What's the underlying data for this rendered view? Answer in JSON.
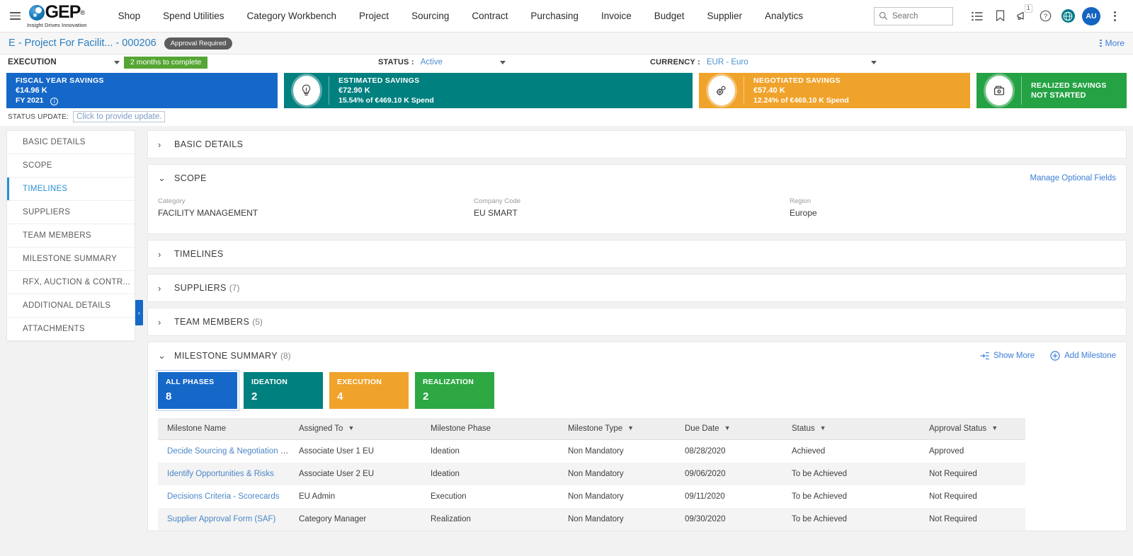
{
  "topnav": {
    "logo_text": "GEP",
    "logo_reg": "®",
    "logo_tagline": "Insight Drives Innovation",
    "links": [
      {
        "label": "Shop"
      },
      {
        "label": "Spend Utilities"
      },
      {
        "label": "Category Workbench"
      },
      {
        "label": "Project"
      },
      {
        "label": "Sourcing"
      },
      {
        "label": "Contract"
      },
      {
        "label": "Purchasing"
      },
      {
        "label": "Invoice"
      },
      {
        "label": "Budget"
      },
      {
        "label": "Supplier"
      },
      {
        "label": "Analytics"
      }
    ],
    "search_placeholder": "Search",
    "search_value": "",
    "notification_badge": "1",
    "avatar_initials": "AU"
  },
  "titlebar": {
    "project_name": "E - Project For Facilit...",
    "project_number": "- 000206",
    "approval_badge": "Approval Required",
    "more_label": "More"
  },
  "phasebar": {
    "phase": "EXECUTION",
    "months_chip": "2 months to complete",
    "status_label": "STATUS :",
    "status_value": "Active",
    "currency_label": "CURRENCY :",
    "currency_value": "EUR - Euro"
  },
  "kpis": [
    {
      "title": "FISCAL YEAR SAVINGS",
      "value": "€14.96 K",
      "sub": "FY 2021",
      "color": "#1668c8",
      "icon": "none",
      "has_info": true
    },
    {
      "title": "ESTIMATED SAVINGS",
      "value": "€72.90 K",
      "sub": "15.54% of €469.10 K Spend",
      "color": "#00807f",
      "icon": "lightbulb-icon"
    },
    {
      "title": "NEGOTIATED SAVINGS",
      "value": "€57.40 K",
      "sub": "12.24% of €469.10 K Spend",
      "color": "#f0a32b",
      "icon": "gears-icon"
    },
    {
      "title": "REALIZED SAVINGS",
      "value": "NOT STARTED",
      "sub": "",
      "color": "#25a244",
      "icon": "wallet-icon"
    }
  ],
  "status_update": {
    "label": "STATUS UPDATE:",
    "placeholder": "Click to provide update."
  },
  "sidebar": {
    "items": [
      {
        "label": "BASIC DETAILS",
        "active": false
      },
      {
        "label": "SCOPE",
        "active": false
      },
      {
        "label": "TIMELINES",
        "active": true
      },
      {
        "label": "SUPPLIERS",
        "active": false
      },
      {
        "label": "TEAM MEMBERS",
        "active": false
      },
      {
        "label": "MILESTONE SUMMARY",
        "active": false
      },
      {
        "label": "RFX, AUCTION & CONTR...",
        "active": false
      },
      {
        "label": "ADDITIONAL DETAILS",
        "active": false
      },
      {
        "label": "ATTACHMENTS",
        "active": false
      }
    ]
  },
  "sections": {
    "basic_details": {
      "title": "BASIC DETAILS",
      "chevron": "›"
    },
    "scope": {
      "title": "SCOPE",
      "chevron": "⌄",
      "manage_link": "Manage Optional Fields",
      "fields": [
        {
          "label": "Category",
          "value": "FACILITY MANAGEMENT"
        },
        {
          "label": "Company Code",
          "value": "EU SMART"
        },
        {
          "label": "Region",
          "value": "Europe"
        }
      ]
    },
    "timelines": {
      "title": "TIMELINES",
      "chevron": "›"
    },
    "suppliers": {
      "title": "SUPPLIERS",
      "count": "(7)",
      "chevron": "›"
    },
    "team_members": {
      "title": "TEAM MEMBERS",
      "count": "(5)",
      "chevron": "›"
    },
    "milestone_summary": {
      "title": "MILESTONE SUMMARY",
      "count": "(8)",
      "chevron": "⌄",
      "show_more": "Show More",
      "add_milestone": "Add Milestone",
      "phase_cards": [
        {
          "label": "ALL PHASES",
          "count": "8",
          "color": "#1668c8",
          "selected": true
        },
        {
          "label": "IDEATION",
          "count": "2",
          "color": "#00807f",
          "selected": false
        },
        {
          "label": "EXECUTION",
          "count": "4",
          "color": "#f0a32b",
          "selected": false
        },
        {
          "label": "REALIZATION",
          "count": "2",
          "color": "#2da843",
          "selected": false
        }
      ],
      "table": {
        "columns": [
          {
            "label": "Milestone Name",
            "filter": false
          },
          {
            "label": "Assigned To",
            "filter": true
          },
          {
            "label": "Milestone Phase",
            "filter": false
          },
          {
            "label": "Milestone Type",
            "filter": true
          },
          {
            "label": "Due Date",
            "filter": true
          },
          {
            "label": "Status",
            "filter": true
          },
          {
            "label": "Approval Status",
            "filter": true
          }
        ],
        "rows": [
          {
            "name": "Decide Sourcing & Negotiation Str...",
            "assigned_to": "Associate User 1 EU",
            "phase": "Ideation",
            "type": "Non Mandatory",
            "due_date": "08/28/2020",
            "status": "Achieved",
            "status_color": "green",
            "approval_status": "Approved"
          },
          {
            "name": "Identify Opportunities & Risks",
            "assigned_to": "Associate User 2 EU",
            "phase": "Ideation",
            "type": "Non Mandatory",
            "due_date": "09/06/2020",
            "status": "To be Achieved",
            "status_color": "red",
            "approval_status": "Not Required"
          },
          {
            "name": "Decisions Criteria - Scorecards",
            "assigned_to": "EU Admin",
            "phase": "Execution",
            "type": "Non Mandatory",
            "due_date": "09/11/2020",
            "status": "To be Achieved",
            "status_color": "red",
            "approval_status": "Not Required"
          },
          {
            "name": "Supplier Approval Form (SAF)",
            "assigned_to": "Category Manager",
            "phase": "Realization",
            "type": "Non Mandatory",
            "due_date": "09/30/2020",
            "status": "To be Achieved",
            "status_color": "red",
            "approval_status": "Not Required"
          }
        ]
      }
    }
  }
}
